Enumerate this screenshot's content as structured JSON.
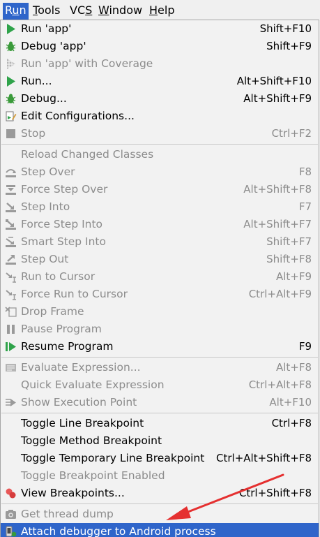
{
  "menubar": {
    "items": [
      {
        "label": "Run",
        "mnemonic_index": 1
      },
      {
        "label": "Tools",
        "mnemonic_index": 0
      },
      {
        "label": "VCS",
        "mnemonic_index": 2
      },
      {
        "label": "Window",
        "mnemonic_index": 0
      },
      {
        "label": "Help",
        "mnemonic_index": 0
      }
    ]
  },
  "menu": {
    "groups": [
      [
        {
          "label": "Run 'app'",
          "shortcut": "Shift+F10",
          "icon": "run-icon",
          "enabled": true
        },
        {
          "label": "Debug 'app'",
          "shortcut": "Shift+F9",
          "icon": "debug-icon",
          "enabled": true
        },
        {
          "label": "Run 'app' with Coverage",
          "shortcut": "",
          "icon": "coverage-icon",
          "enabled": false
        },
        {
          "label": "Run...",
          "shortcut": "Alt+Shift+F10",
          "icon": "run-icon",
          "enabled": true
        },
        {
          "label": "Debug...",
          "shortcut": "Alt+Shift+F9",
          "icon": "debug-icon",
          "enabled": true
        },
        {
          "label": "Edit Configurations...",
          "shortcut": "",
          "icon": "edit-config-icon",
          "enabled": true
        },
        {
          "label": "Stop",
          "shortcut": "Ctrl+F2",
          "icon": "stop-icon",
          "enabled": false
        }
      ],
      [
        {
          "label": "Reload Changed Classes",
          "shortcut": "",
          "icon": "",
          "enabled": false
        },
        {
          "label": "Step Over",
          "shortcut": "F8",
          "icon": "step-over-icon",
          "enabled": false
        },
        {
          "label": "Force Step Over",
          "shortcut": "Alt+Shift+F8",
          "icon": "force-step-over-icon",
          "enabled": false
        },
        {
          "label": "Step Into",
          "shortcut": "F7",
          "icon": "step-into-icon",
          "enabled": false
        },
        {
          "label": "Force Step Into",
          "shortcut": "Alt+Shift+F7",
          "icon": "force-step-into-icon",
          "enabled": false
        },
        {
          "label": "Smart Step Into",
          "shortcut": "Shift+F7",
          "icon": "smart-step-into-icon",
          "enabled": false
        },
        {
          "label": "Step Out",
          "shortcut": "Shift+F8",
          "icon": "step-out-icon",
          "enabled": false
        },
        {
          "label": "Run to Cursor",
          "shortcut": "Alt+F9",
          "icon": "run-to-cursor-icon",
          "enabled": false
        },
        {
          "label": "Force Run to Cursor",
          "shortcut": "Ctrl+Alt+F9",
          "icon": "force-run-to-cursor-icon",
          "enabled": false
        },
        {
          "label": "Drop Frame",
          "shortcut": "",
          "icon": "drop-frame-icon",
          "enabled": false
        },
        {
          "label": "Pause Program",
          "shortcut": "",
          "icon": "pause-icon",
          "enabled": false
        },
        {
          "label": "Resume Program",
          "shortcut": "F9",
          "icon": "resume-icon",
          "enabled": true
        }
      ],
      [
        {
          "label": "Evaluate Expression...",
          "shortcut": "Alt+F8",
          "icon": "evaluate-icon",
          "enabled": false
        },
        {
          "label": "Quick Evaluate Expression",
          "shortcut": "Ctrl+Alt+F8",
          "icon": "",
          "enabled": false
        },
        {
          "label": "Show Execution Point",
          "shortcut": "Alt+F10",
          "icon": "execution-point-icon",
          "enabled": false
        }
      ],
      [
        {
          "label": "Toggle Line Breakpoint",
          "shortcut": "Ctrl+F8",
          "icon": "",
          "enabled": true
        },
        {
          "label": "Toggle Method Breakpoint",
          "shortcut": "",
          "icon": "",
          "enabled": true
        },
        {
          "label": "Toggle Temporary Line Breakpoint",
          "shortcut": "Ctrl+Alt+Shift+F8",
          "icon": "",
          "enabled": true
        },
        {
          "label": "Toggle Breakpoint Enabled",
          "shortcut": "",
          "icon": "",
          "enabled": false
        },
        {
          "label": "View Breakpoints...",
          "shortcut": "Ctrl+Shift+F8",
          "icon": "breakpoints-icon",
          "enabled": true
        }
      ],
      [
        {
          "label": "Get thread dump",
          "shortcut": "",
          "icon": "camera-icon",
          "enabled": false
        },
        {
          "label": "Attach debugger to Android process",
          "shortcut": "",
          "icon": "attach-debugger-icon",
          "enabled": true,
          "selected": true
        }
      ]
    ]
  },
  "colors": {
    "accent": "#2f65ca",
    "annotation": "#e53030",
    "run_green": "#2fa34a",
    "disabled_text": "#8c8c8c"
  }
}
